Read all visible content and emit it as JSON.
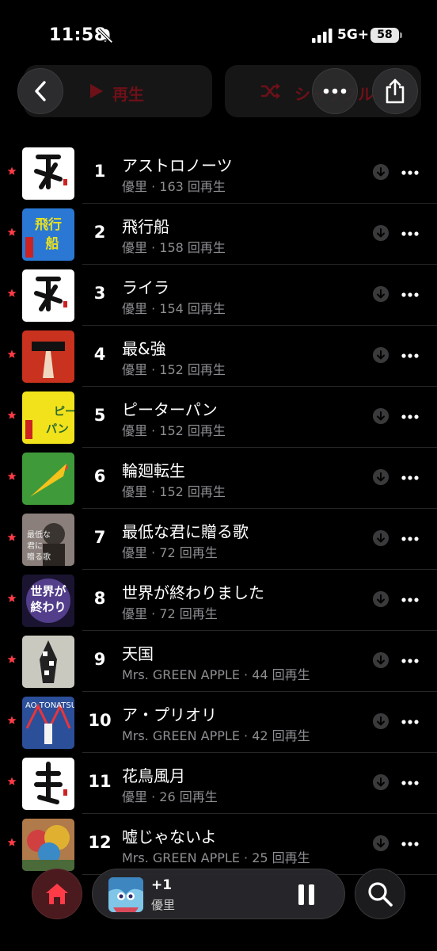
{
  "status_bar": {
    "time": "11:58",
    "network": "5G+",
    "battery": "58"
  },
  "top_actions": {
    "play_label": "再生",
    "shuffle_label": "シャッフル"
  },
  "songs": [
    {
      "rank": "1",
      "title": "アストロノーツ",
      "artist": "優里",
      "plays": "163 回再生",
      "art_color": "#ffffff"
    },
    {
      "rank": "2",
      "title": "飛行船",
      "artist": "優里",
      "plays": "158 回再生",
      "art_color": "#2a78d4"
    },
    {
      "rank": "3",
      "title": "ライラ",
      "artist": "優里",
      "plays": "154 回再生",
      "art_color": "#ffffff"
    },
    {
      "rank": "4",
      "title": "最&強",
      "artist": "優里",
      "plays": "152 回再生",
      "art_color": "#c8321e"
    },
    {
      "rank": "5",
      "title": "ピーターパン",
      "artist": "優里",
      "plays": "152 回再生",
      "art_color": "#f2e21c"
    },
    {
      "rank": "6",
      "title": "輪廻転生",
      "artist": "優里",
      "plays": "152 回再生",
      "art_color": "#3f9b3a"
    },
    {
      "rank": "7",
      "title": "最低な君に贈る歌",
      "artist": "優里",
      "plays": "72 回再生",
      "art_color": "#8a7f7a"
    },
    {
      "rank": "8",
      "title": "世界が終わりました",
      "artist": "優里",
      "plays": "72 回再生",
      "art_color": "#1a1430"
    },
    {
      "rank": "9",
      "title": "天国",
      "artist": "Mrs. GREEN APPLE",
      "plays": "44 回再生",
      "art_color": "#c9c9c0"
    },
    {
      "rank": "10",
      "title": "ア・プリオリ",
      "artist": "Mrs. GREEN APPLE",
      "plays": "42 回再生",
      "art_color": "#2c4f9a"
    },
    {
      "rank": "11",
      "title": "花鳥風月",
      "artist": "優里",
      "plays": "26 回再生",
      "art_color": "#ffffff"
    },
    {
      "rank": "12",
      "title": "嘘じゃないよ",
      "artist": "Mrs. GREEN APPLE",
      "plays": "25 回再生",
      "art_color": "#b07a4a"
    }
  ],
  "mini_player": {
    "title": "+1",
    "artist": "優里"
  },
  "colors": {
    "accent": "#ff3b47",
    "background": "#000000",
    "secondary_text": "#8e8e93"
  },
  "icons": [
    "chevron-left-icon",
    "play-icon",
    "shuffle-icon",
    "more-icon",
    "share-icon",
    "star-icon",
    "download-icon",
    "home-icon",
    "pause-icon",
    "search-icon"
  ]
}
